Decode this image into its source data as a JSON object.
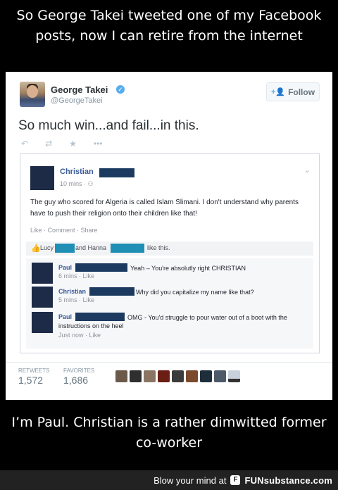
{
  "caption_top": "So George Takei tweeted one of my Facebook posts, now I can retire from the internet",
  "caption_bottom": "I’m Paul. Christian is a rather dimwitted former co-worker",
  "tweet": {
    "author_name": "George Takei",
    "author_handle": "@GeorgeTakei",
    "follow_label": "Follow",
    "text": "So much win...and fail...in this.",
    "stats": {
      "retweets_label": "RETWEETS",
      "retweets_value": "1,572",
      "favorites_label": "FAVORITES",
      "favorites_value": "1,686"
    }
  },
  "fb_post": {
    "author": "Christian",
    "time": "10 mins · ",
    "text": "The guy who scored for Algeria is called Islam Slimani. I don't understand why parents have to push their religion onto their children like that!",
    "links": "Like · Comment · Share",
    "likes": {
      "name1": "Lucy",
      "and": "and Hanna",
      "suffix": "like this."
    },
    "comments": [
      {
        "author": "Paul",
        "text": "Yeah – You're absolutly right CHRISTIAN",
        "meta": "6 mins · Like"
      },
      {
        "author": "Christian",
        "text": "Why did you capitalize my name like that?",
        "meta": "5 mins · Like"
      },
      {
        "author": "Paul",
        "text": "OMG - You'd struggle to pour water out of a boot with the instructions on the heel",
        "meta": "Just now · Like"
      }
    ]
  },
  "footer": {
    "prefix": "Blow your mind at",
    "brand": "FUNsubstance.com"
  },
  "colors": {
    "fb_blue": "#3b5998",
    "twitter_blue": "#55acee",
    "redaction_navy": "#1c3a5f",
    "redaction_teal": "#1f8fb6"
  }
}
